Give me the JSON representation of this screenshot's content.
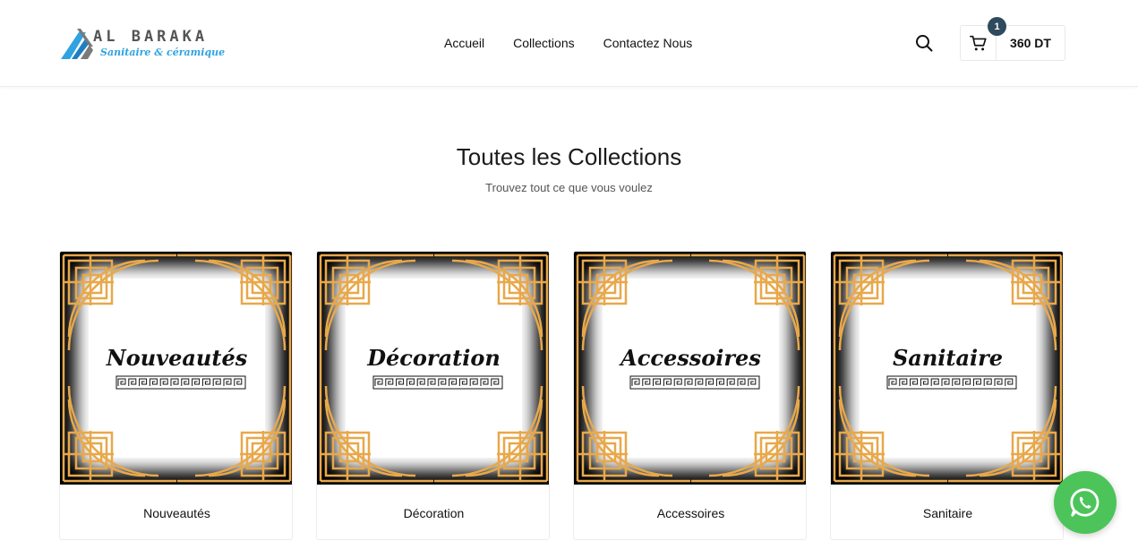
{
  "brand": {
    "name": "AL BARAKA",
    "tagline": "Sanitaire & céramique",
    "colors": {
      "accent": "#2fa3e0",
      "mark_gray": "#7a7a7a"
    }
  },
  "nav": {
    "items": [
      {
        "label": "Accueil"
      },
      {
        "label": "Collections"
      },
      {
        "label": "Contactez Nous"
      }
    ]
  },
  "header": {
    "search_icon": "search-icon",
    "cart": {
      "icon": "cart-icon",
      "count": "1",
      "total": "360 DT",
      "badge_color": "#2e4a5c"
    }
  },
  "page": {
    "title": "Toutes les Collections",
    "subtitle": "Trouvez tout ce que vous voulez"
  },
  "collections": [
    {
      "image_label": "Nouveautés",
      "name": "Nouveautés"
    },
    {
      "image_label": "Décoration",
      "name": "Décoration"
    },
    {
      "image_label": "Accessoires",
      "name": "Accessoires"
    },
    {
      "image_label": "Sanitaire",
      "name": "Sanitaire"
    }
  ],
  "frame_colors": {
    "gold": "#e8a84a",
    "background": "#000000"
  },
  "whatsapp": {
    "icon": "whatsapp-icon",
    "color": "#4cc45a"
  }
}
